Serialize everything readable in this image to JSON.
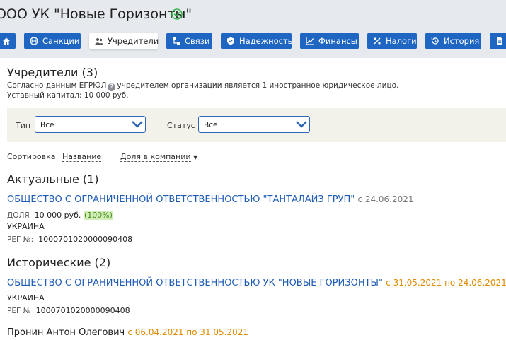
{
  "header": {
    "title": "ООО УК \"Новые Горизонты\""
  },
  "tabs": [
    {
      "label": ""
    },
    {
      "label": "Санкции"
    },
    {
      "label": "Учредители"
    },
    {
      "label": "Связи"
    },
    {
      "label": "Надежность"
    },
    {
      "label": "Финансы"
    },
    {
      "label": "Налоги"
    },
    {
      "label": "История"
    },
    {
      "label": ""
    }
  ],
  "founders": {
    "title": "Учредители (3)",
    "note_prefix": "Согласно данным ЕГРЮЛ",
    "note_suffix": "учредителем организации является 1 иностранное юридическое лицо.",
    "capital": "Уставный капитал: 10 000 руб."
  },
  "filters": {
    "type_label": "Тип",
    "type_value": "Все",
    "status_label": "Статус",
    "status_value": "Все"
  },
  "sort": {
    "label": "Сортировка",
    "by_name": "Название",
    "by_share": "Доля в компании"
  },
  "actual": {
    "title": "Актуальные (1)",
    "items": [
      {
        "name": "ОБЩЕСТВО С ОГРАНИЧЕННОЙ ОТВЕТСТВЕННОСТЬЮ \"ТАНТАЛАЙЗ ГРУП\"",
        "date": "с 24.06.2021",
        "share_label": "ДОЛЯ",
        "share_value": "10 000 руб.",
        "share_pct": "(100%)",
        "country": "УКРАИНА",
        "reg_label": "РЕГ №:",
        "reg_value": "1000701020000090408"
      }
    ]
  },
  "historic": {
    "title": "Исторические (2)",
    "items": [
      {
        "name": "ОБЩЕСТВО С ОГРАНИЧЕННОЙ ОТВЕТСТВЕННОСТЬЮ УК \"НОВЫЕ ГОРИЗОНТЫ\"",
        "date": "с 31.05.2021 по 24.06.2021",
        "country": "УКРАИНА",
        "reg_label": "РЕГ №",
        "reg_value": "1000701020000090408"
      },
      {
        "name": "Пронин Антон Олегович",
        "date": "с 06.04.2021 по 31.05.2021"
      }
    ]
  },
  "colors": {
    "accent": "#1f66c2",
    "success": "#37b24d",
    "date_orange": "#e08a00"
  }
}
